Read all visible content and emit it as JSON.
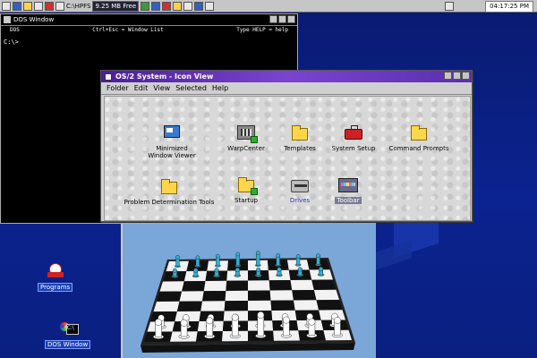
{
  "taskbar": {
    "drive_label": "C:\\HPFS",
    "free_space": "9.25 MB Free",
    "clock": "04:17:25 PM"
  },
  "dos_window": {
    "title": "DOS Window",
    "hint_left": "DOS",
    "hint_center": "Ctrl+Esc = Window List",
    "hint_right": "Type HELP = help",
    "prompt": "C:\\>"
  },
  "os2_window": {
    "title": "OS/2 System - Icon View",
    "menu": [
      "Folder",
      "Edit",
      "View",
      "Selected",
      "Help"
    ],
    "objects": [
      {
        "label": "Minimized\nWindow Viewer",
        "icon": "window-viewer-icon"
      },
      {
        "label": "WarpCenter",
        "icon": "warpcenter-icon"
      },
      {
        "label": "Templates",
        "icon": "folder-icon"
      },
      {
        "label": "System Setup",
        "icon": "toolbox-icon"
      },
      {
        "label": "Command Prompts",
        "icon": "folder-icon"
      },
      {
        "label": "Problem Determination Tools",
        "icon": "folder-icon"
      },
      {
        "label": "Startup",
        "icon": "folder-icon"
      },
      {
        "label": "Drives",
        "icon": "drive-icon"
      },
      {
        "label": "Toolbar",
        "icon": "toolbar-icon"
      }
    ]
  },
  "desktop_icons": [
    {
      "label": "Programs",
      "icon": "programs-icon"
    },
    {
      "label": "DOS Window",
      "icon": "dos-window-icon"
    }
  ],
  "colors": {
    "desktop": "#0b2390",
    "os2_titlebar": "#6a3cc8",
    "chess_background": "#7aa7d8",
    "chess_pieces_dark": "#2fb0d8",
    "chess_pieces_light": "#ffffff"
  }
}
